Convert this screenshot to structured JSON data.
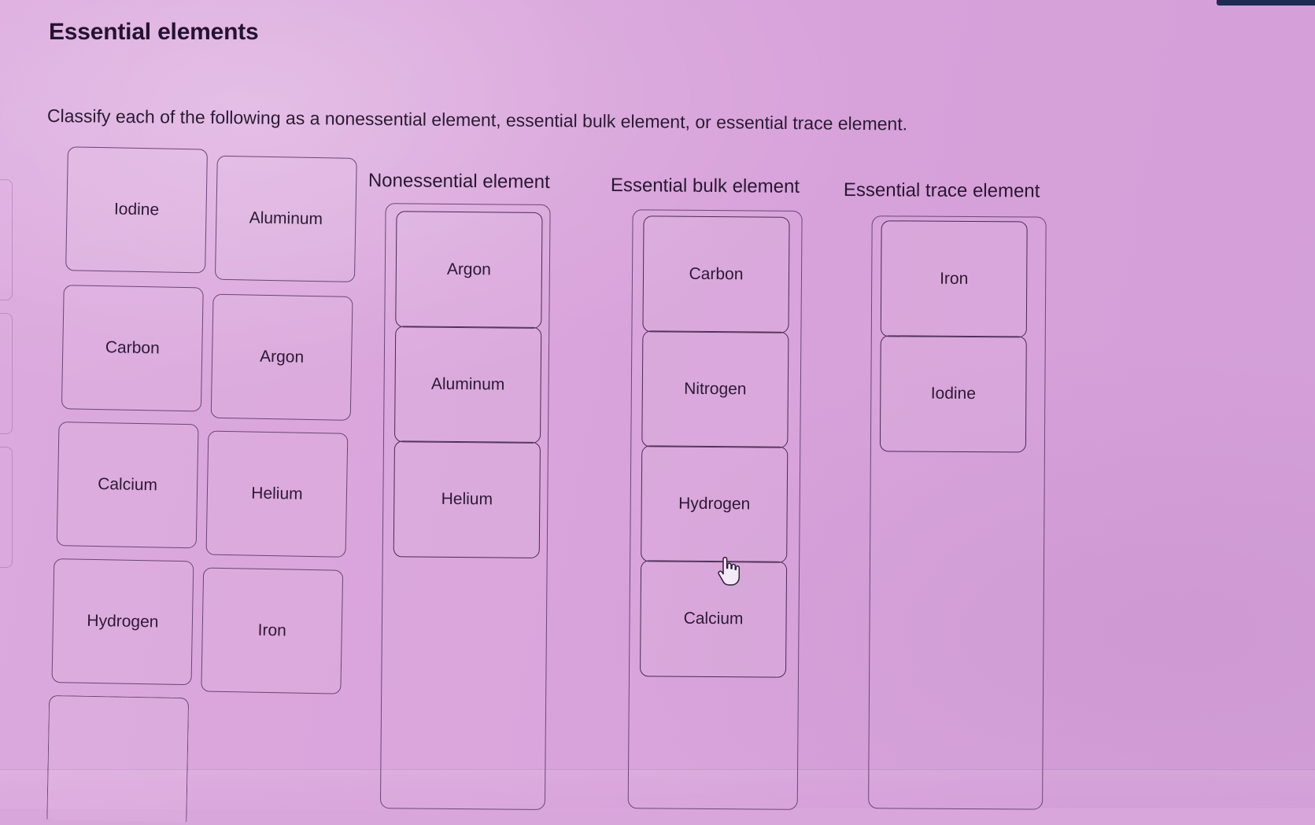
{
  "page": {
    "title": "Essential elements",
    "prompt": "Classify each of the following as a nonessential element, essential bulk element, or essential trace element.",
    "background_color": "#d9a4db",
    "text_color": "#2b1a33",
    "tile_border_color": "#5b3a68",
    "edge_strip_color": "#1e2c54"
  },
  "bank": {
    "name": "element-source-bank",
    "tiles": [
      {
        "label": "Iodine"
      },
      {
        "label": "Aluminum"
      },
      {
        "label": "Carbon"
      },
      {
        "label": "Argon"
      },
      {
        "label": "Calcium"
      },
      {
        "label": "Helium"
      },
      {
        "label": "Hydrogen"
      },
      {
        "label": "Iron"
      },
      {
        "label": ""
      }
    ]
  },
  "columns": [
    {
      "header": "Nonessential element",
      "tiles": [
        {
          "label": "Argon"
        },
        {
          "label": "Aluminum"
        },
        {
          "label": "Helium"
        }
      ]
    },
    {
      "header": "Essential bulk element",
      "tiles": [
        {
          "label": "Carbon"
        },
        {
          "label": "Nitrogen"
        },
        {
          "label": "Hydrogen"
        },
        {
          "label": "Calcium"
        }
      ]
    },
    {
      "header": "Essential trace element",
      "tiles": [
        {
          "label": "Iron"
        },
        {
          "label": "Iodine"
        }
      ]
    }
  ],
  "cursor": {
    "icon": "pointing-hand-cursor"
  }
}
